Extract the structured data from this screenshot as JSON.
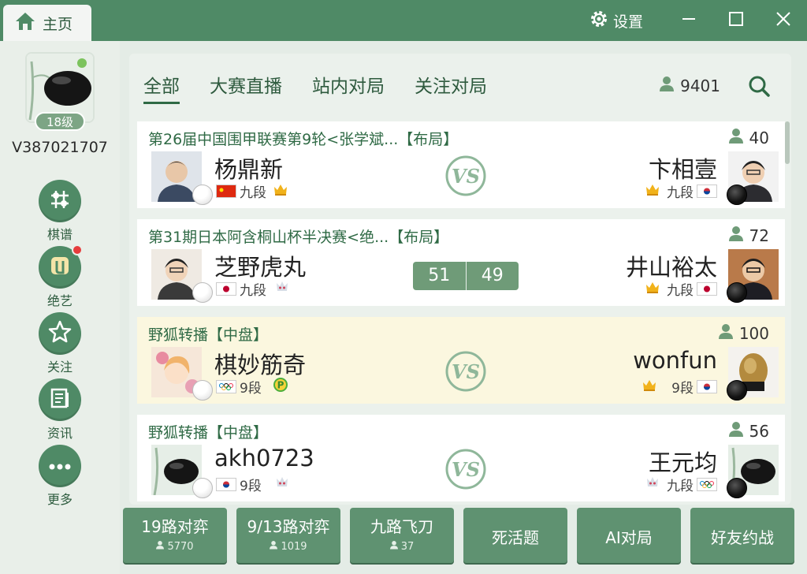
{
  "titlebar": {
    "home_label": "主页",
    "settings_label": "设置"
  },
  "user": {
    "level": "18级",
    "id": "V387021707"
  },
  "sidebar": {
    "items": [
      {
        "label": "棋谱"
      },
      {
        "label": "绝艺"
      },
      {
        "label": "关注"
      },
      {
        "label": "资讯"
      },
      {
        "label": "更多"
      }
    ]
  },
  "tabs": [
    {
      "label": "全部",
      "active": true
    },
    {
      "label": "大赛直播"
    },
    {
      "label": "站内对局"
    },
    {
      "label": "关注对局"
    }
  ],
  "online_count": "9401",
  "games": [
    {
      "title": "第26届中国围甲联赛第9轮<张学斌...【布局】",
      "viewers": "40",
      "left": {
        "name": "杨鼎新",
        "rank": "九段",
        "flag": "cn"
      },
      "right": {
        "name": "卞相壹",
        "rank": "九段",
        "flag": "kr"
      }
    },
    {
      "title": "第31期日本阿含桐山杯半决赛<绝...【布局】",
      "viewers": "72",
      "left": {
        "name": "芝野虎丸",
        "rank": "九段",
        "flag": "jp"
      },
      "right": {
        "name": "井山裕太",
        "rank": "九段",
        "flag": "jp"
      },
      "score": {
        "left": "51",
        "right": "49"
      }
    },
    {
      "title": "野狐转播【中盘】",
      "viewers": "100",
      "left": {
        "name": "棋妙筋奇",
        "rank": "9段",
        "flag": "olympic"
      },
      "right": {
        "name": "wonfun",
        "rank": "9段",
        "flag": "kr"
      }
    },
    {
      "title": "野狐转播【中盘】",
      "viewers": "56",
      "left": {
        "name": "akh0723",
        "rank": "9段",
        "flag": "kr"
      },
      "right": {
        "name": "王元均",
        "rank": "九段",
        "flag": "olympic"
      }
    }
  ],
  "bottom_buttons": [
    {
      "label": "19路对弈",
      "count": "5770"
    },
    {
      "label": "9/13路对弈",
      "count": "1019"
    },
    {
      "label": "九路飞刀",
      "count": "37"
    },
    {
      "label": "死活题"
    },
    {
      "label": "AI对局"
    },
    {
      "label": "好友约战"
    }
  ],
  "colors": {
    "primary": "#4f8a66",
    "accent": "#2f6a45",
    "highlight_card": "#fbf7df"
  }
}
